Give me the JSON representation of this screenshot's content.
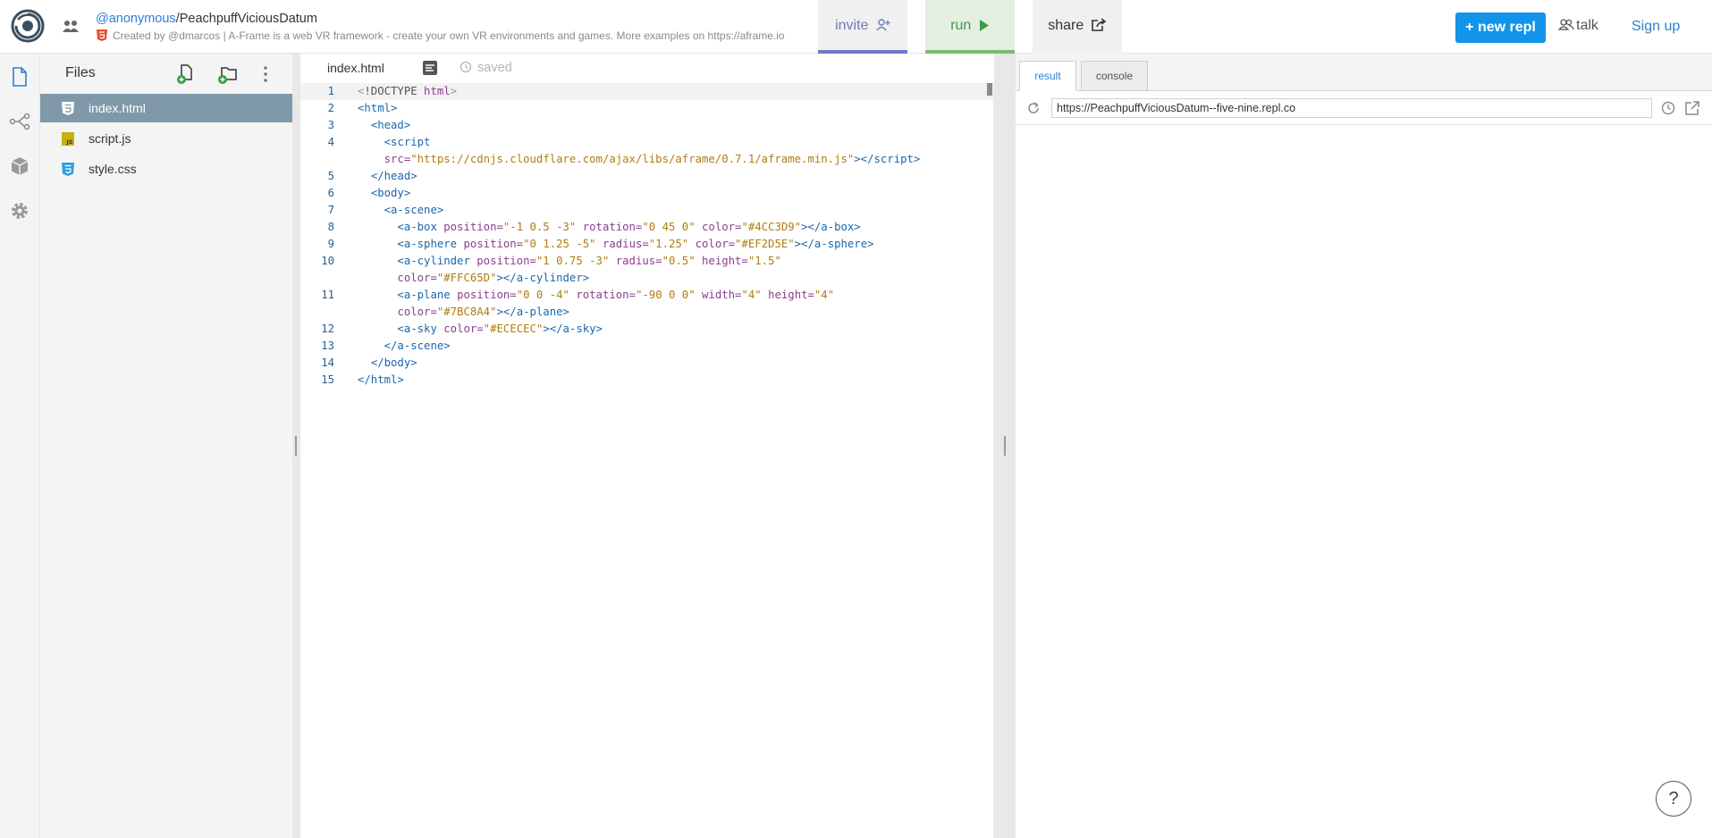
{
  "header": {
    "owner": "@anonymous",
    "separator": "/",
    "repl_name": "PeachpuffViciousDatum",
    "description": "Created by @dmarcos | A-Frame is a web VR framework - create your own VR environments and games. More examples on https://aframe.io",
    "invite_label": "invite",
    "run_label": "run",
    "share_label": "share",
    "new_repl_label": "new repl",
    "talk_label": "talk",
    "signup_label": "Sign up",
    "colors": {
      "accent": "#1194e9",
      "run": "#3d9b45",
      "invite": "#6b7bc4"
    }
  },
  "rail": {
    "icons": [
      "files-icon",
      "version-control-icon",
      "packages-icon",
      "settings-icon"
    ]
  },
  "files": {
    "title": "Files",
    "items": [
      {
        "name": "index.html",
        "icon": "html5-icon",
        "active": true
      },
      {
        "name": "script.js",
        "icon": "js-icon",
        "active": false
      },
      {
        "name": "style.css",
        "icon": "css3-icon",
        "active": false
      }
    ]
  },
  "editor": {
    "tab": "index.html",
    "status": "saved",
    "lines": [
      {
        "n": "1",
        "html": "<span class=\"t-br\">&lt;</span><span class=\"t-doc\">!DOCTYPE</span> <span class=\"t-kw\">html</span><span class=\"t-br\">&gt;</span>"
      },
      {
        "n": "2",
        "html": "<span class=\"t-tag\">&lt;html&gt;</span>"
      },
      {
        "n": "3",
        "html": "  <span class=\"t-tag\">&lt;head&gt;</span>"
      },
      {
        "n": "4",
        "html": "    <span class=\"t-tag\">&lt;script</span>"
      },
      {
        "n": "",
        "html": "    <span class=\"t-attr\">src=</span><span class=\"t-str\">\"https://cdnjs.cloudflare.com/ajax/libs/aframe/0.7.1/aframe.min.js\"</span><span class=\"t-tag\">&gt;&lt;/script&gt;</span>"
      },
      {
        "n": "5",
        "html": "  <span class=\"t-tag\">&lt;/head&gt;</span>"
      },
      {
        "n": "6",
        "html": "  <span class=\"t-tag\">&lt;body&gt;</span>"
      },
      {
        "n": "7",
        "html": "    <span class=\"t-tag\">&lt;a-scene&gt;</span>"
      },
      {
        "n": "8",
        "html": "      <span class=\"t-tag\">&lt;a-box</span> <span class=\"t-attr\">position=</span><span class=\"t-str\">\"-1 0.5 -3\"</span> <span class=\"t-attr\">rotation=</span><span class=\"t-str\">\"0 45 0\"</span> <span class=\"t-attr\">color=</span><span class=\"t-str\">\"#4CC3D9\"</span><span class=\"t-tag\">&gt;&lt;/a-box&gt;</span>"
      },
      {
        "n": "9",
        "html": "      <span class=\"t-tag\">&lt;a-sphere</span> <span class=\"t-attr\">position=</span><span class=\"t-str\">\"0 1.25 -5\"</span> <span class=\"t-attr\">radius=</span><span class=\"t-str\">\"1.25\"</span> <span class=\"t-attr\">color=</span><span class=\"t-str\">\"#EF2D5E\"</span><span class=\"t-tag\">&gt;&lt;/a-sphere&gt;</span>"
      },
      {
        "n": "10",
        "html": "      <span class=\"t-tag\">&lt;a-cylinder</span> <span class=\"t-attr\">position=</span><span class=\"t-str\">\"1 0.75 -3\"</span> <span class=\"t-attr\">radius=</span><span class=\"t-str\">\"0.5\"</span> <span class=\"t-attr\">height=</span><span class=\"t-str\">\"1.5\"</span>"
      },
      {
        "n": "",
        "html": "      <span class=\"t-attr\">color=</span><span class=\"t-str\">\"#FFC65D\"</span><span class=\"t-tag\">&gt;&lt;/a-cylinder&gt;</span>"
      },
      {
        "n": "11",
        "html": "      <span class=\"t-tag\">&lt;a-plane</span> <span class=\"t-attr\">position=</span><span class=\"t-str\">\"0 0 -4\"</span> <span class=\"t-attr\">rotation=</span><span class=\"t-str\">\"-90 0 0\"</span> <span class=\"t-attr\">width=</span><span class=\"t-str\">\"4\"</span> <span class=\"t-attr\">height=</span><span class=\"t-str\">\"4\"</span>"
      },
      {
        "n": "",
        "html": "      <span class=\"t-attr\">color=</span><span class=\"t-str\">\"#7BC8A4\"</span><span class=\"t-tag\">&gt;&lt;/a-plane&gt;</span>"
      },
      {
        "n": "12",
        "html": "      <span class=\"t-tag\">&lt;a-sky</span> <span class=\"t-attr\">color=</span><span class=\"t-str\">\"#ECECEC\"</span><span class=\"t-tag\">&gt;&lt;/a-sky&gt;</span>"
      },
      {
        "n": "13",
        "html": "    <span class=\"t-tag\">&lt;/a-scene&gt;</span>"
      },
      {
        "n": "14",
        "html": "  <span class=\"t-tag\">&lt;/body&gt;</span>"
      },
      {
        "n": "15",
        "html": "<span class=\"t-tag\">&lt;/html&gt;</span>"
      }
    ]
  },
  "result": {
    "tabs": [
      "result",
      "console"
    ],
    "url": "https://PeachpuffViciousDatum--five-nine.repl.co",
    "help_label": "?"
  }
}
